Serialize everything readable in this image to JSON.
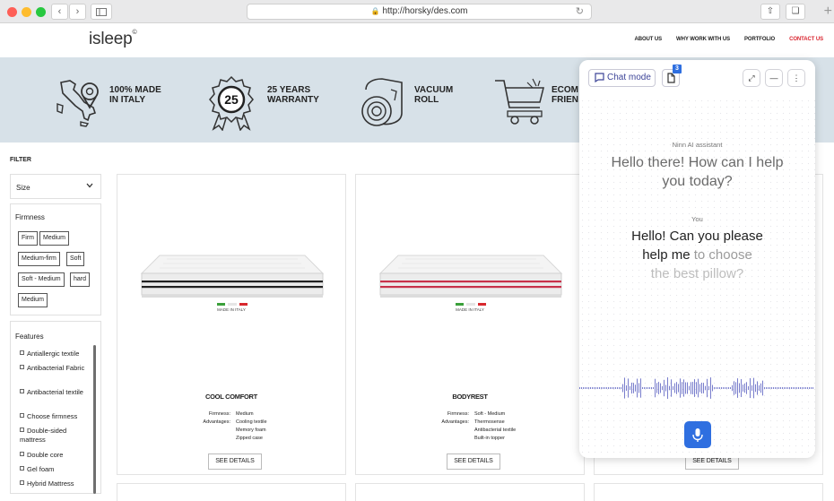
{
  "browser": {
    "url": "http://horsky/des.com",
    "back_icon": "chevron-left-icon",
    "forward_icon": "chevron-right-icon"
  },
  "site": {
    "logo": "isleep",
    "logo_mark": "©",
    "nav": [
      "ABOUT US",
      "WHY WORK WITH US",
      "PORTFOLIO",
      "CONTACT US"
    ],
    "active_nav": "CONTACT US",
    "accent_color": "#d9232d"
  },
  "features": [
    {
      "icon": "italy-map-pin-icon",
      "line1": "100% MADE",
      "line2": "IN ITALY"
    },
    {
      "icon": "award-badge-icon",
      "badge": "25",
      "line1": "25 YEARS",
      "line2": "WARRANTY"
    },
    {
      "icon": "rolled-mattress-icon",
      "line1": "VACUUM",
      "line2": "ROLL"
    },
    {
      "icon": "shopping-cart-icon",
      "line1": "ECOM",
      "line2": "FRIEN"
    }
  ],
  "filter": {
    "title": "FILTER",
    "size_label": "Size",
    "firmness_title": "Firmness",
    "firmness_options": [
      "Firm",
      "Medium",
      "Medium-firm",
      "Soft",
      "Soft - Medium",
      "hard",
      "Medium"
    ],
    "features_title": "Features",
    "features_options": [
      "Antiallergic textile",
      "Antibacterial Fabric",
      "Antibacterial textile",
      "Choose firmness",
      "Double-sided mattress",
      "Double core",
      "Gel foam",
      "Hybrid Mattress"
    ]
  },
  "products": [
    {
      "name": "COOL COMFORT",
      "made_label": "MADE IN ITALY",
      "firmness_key": "Firmness:",
      "firmness": "Medium",
      "advantages_key": "Advantages:",
      "advantages": [
        "Cooling textile",
        "Memory foam",
        "Zipped case"
      ],
      "stripe_color": "#222222",
      "button": "SEE DETAILS"
    },
    {
      "name": "BODYREST",
      "made_label": "MADE IN ITALY",
      "firmness_key": "Firmness:",
      "firmness": "Soft - Medium",
      "advantages_key": "Advantages:",
      "advantages": [
        "Thermosense",
        "Antibacterial textile",
        "Built-in topper"
      ],
      "stripe_color": "#c8324a",
      "button": "SEE DETAILS"
    },
    {
      "button": "SEE DETAILS"
    }
  ],
  "chat": {
    "mode_label": "Chat mode",
    "doc_badge": "3",
    "ai_label": "Ninn AI assistant",
    "ai_message_1": "Hello there! How can I help",
    "ai_message_2": "you today?",
    "user_label": "You",
    "user_line1": "Hello! Can you please",
    "user_line2a": "help me",
    "user_line2b": " to choose",
    "user_line3": "the best pillow?",
    "accent_color": "#2f6fe0"
  }
}
